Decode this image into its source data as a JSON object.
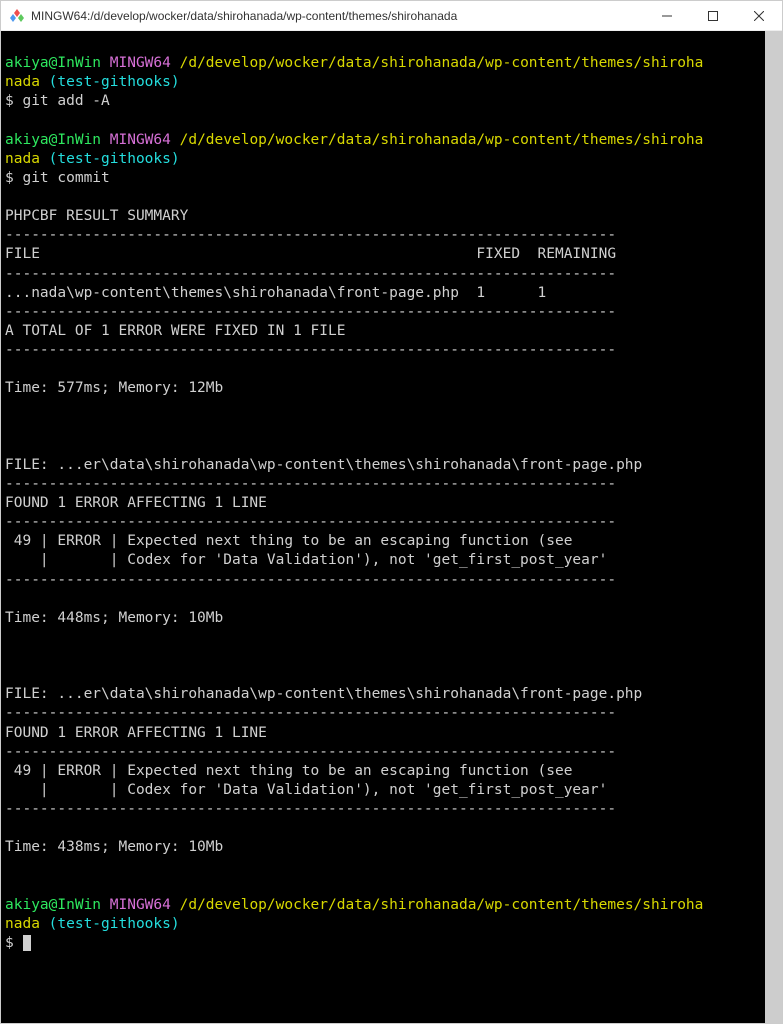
{
  "titlebar": {
    "title": "MINGW64:/d/develop/wocker/data/shirohanada/wp-content/themes/shirohanada"
  },
  "prompt": {
    "user": "akiya@InWin",
    "host": "MINGW64",
    "path": "/d/develop/wocker/data/shirohanada/wp-content/themes/shiroha",
    "path_line2": "nada",
    "branch": "(test-githooks)",
    "symbol": "$"
  },
  "commands": {
    "cmd1": "git add -A",
    "cmd2": "git commit"
  },
  "output": {
    "blank": "",
    "summary_header": "PHPCBF RESULT SUMMARY",
    "dash_full": "----------------------------------------------------------------------",
    "table_header": "FILE                                                  FIXED  REMAINING",
    "table_row": "...nada\\wp-content\\themes\\shirohanada\\front-page.php  1      1",
    "total_line": "A TOTAL OF 1 ERROR WERE FIXED IN 1 FILE",
    "time1": "Time: 577ms; Memory: 12Mb",
    "file_line": "FILE: ...er\\data\\shirohanada\\wp-content\\themes\\shirohanada\\front-page.php",
    "found_line": "FOUND 1 ERROR AFFECTING 1 LINE",
    "err_row1": " 49 | ERROR | Expected next thing to be an escaping function (see",
    "err_row2": "    |       | Codex for 'Data Validation'), not 'get_first_post_year'",
    "time2": "Time: 448ms; Memory: 10Mb",
    "time3": "Time: 438ms; Memory: 10Mb"
  }
}
